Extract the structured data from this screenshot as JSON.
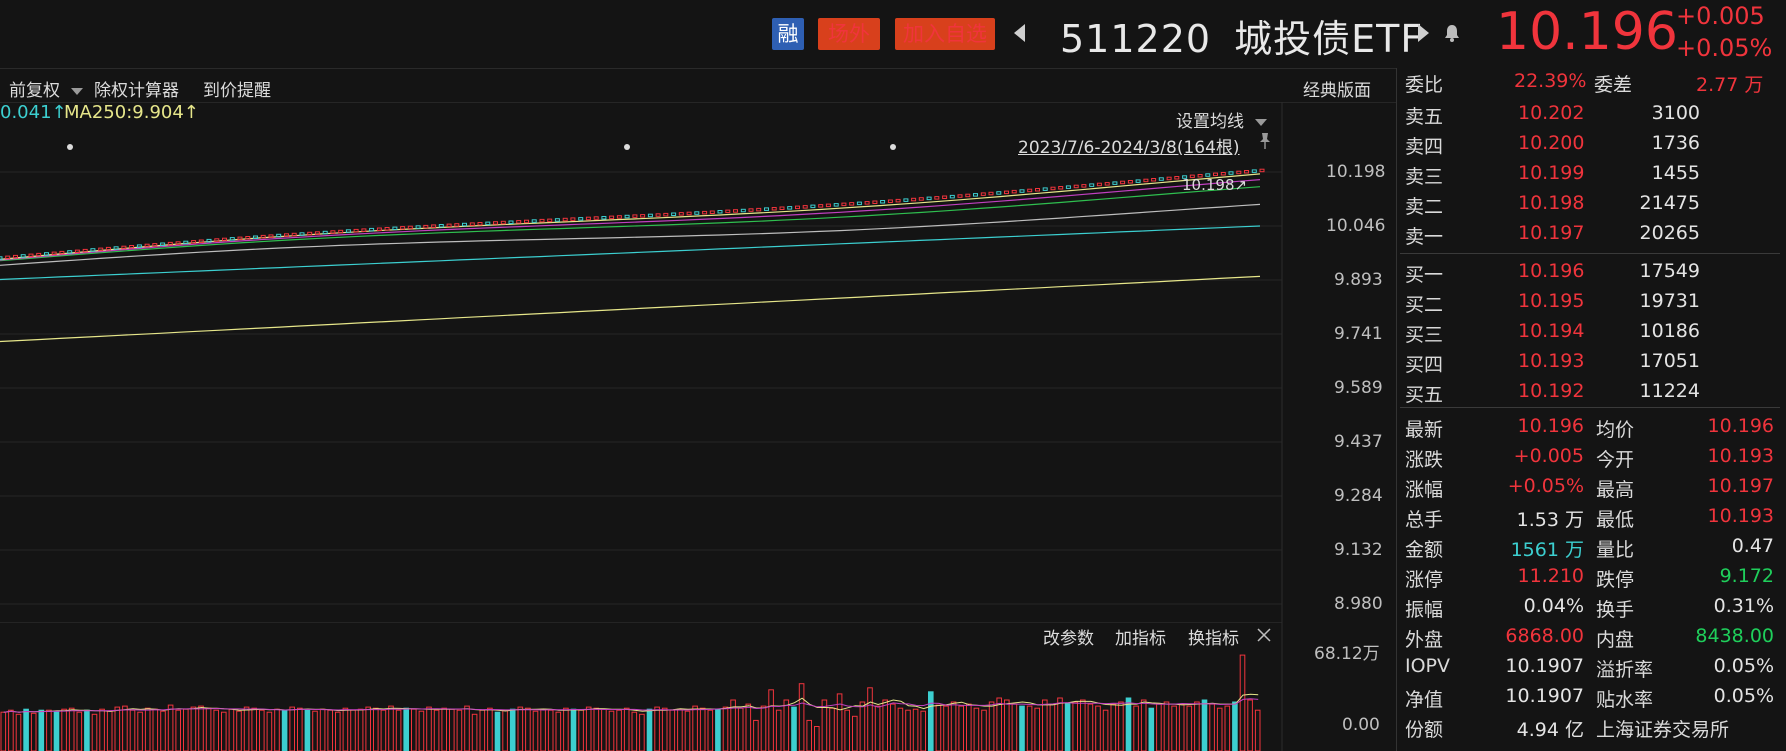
{
  "header": {
    "tag_margin": "融",
    "tag_offsite": "场外",
    "tag_watchlist": "加入自选",
    "code": "511220",
    "name": "城投债ETF",
    "price": "10.196",
    "change": "+0.005",
    "change_pct": "+0.05%"
  },
  "toolbar": {
    "adjust": "前复权",
    "calculator": "除权计算器",
    "alert": "到价提醒",
    "classic": "经典版面",
    "ma_left": "0.041↑",
    "ma250": "MA250:9.904↑",
    "set_ma": "设置均线",
    "range": "2023/7/6-2024/3/8(164根)",
    "last_label": "10.198↗"
  },
  "yaxis": [
    "10.198",
    "10.046",
    "9.893",
    "9.741",
    "9.589",
    "9.437",
    "9.284",
    "9.132",
    "8.980"
  ],
  "volume": {
    "change_params": "改参数",
    "add_indicator": "加指标",
    "switch_indicator": "换指标",
    "max": "68.12万",
    "min": "0.00",
    "bars": [
      0.38,
      0.4,
      0.36,
      0.41,
      0.37,
      0.4,
      0.4,
      0.39,
      0.41,
      0.42,
      0.38,
      0.4,
      0.36,
      0.41,
      0.39,
      0.43,
      0.44,
      0.4,
      0.38,
      0.42,
      0.41,
      0.39,
      0.45,
      0.4,
      0.41,
      0.43,
      0.44,
      0.42,
      0.4,
      0.38,
      0.41,
      0.39,
      0.43,
      0.42,
      0.4,
      0.38,
      0.41,
      0.4,
      0.43,
      0.42,
      0.4,
      0.39,
      0.41,
      0.4,
      0.38,
      0.42,
      0.4,
      0.41,
      0.43,
      0.42,
      0.4,
      0.44,
      0.4,
      0.42,
      0.41,
      0.39,
      0.43,
      0.4,
      0.42,
      0.41,
      0.4,
      0.44,
      0.36,
      0.4,
      0.42,
      0.38,
      0.4,
      0.41,
      0.43,
      0.42,
      0.39,
      0.41,
      0.4,
      0.38,
      0.42,
      0.41,
      0.4,
      0.43,
      0.42,
      0.41,
      0.39,
      0.4,
      0.42,
      0.38,
      0.36,
      0.41,
      0.43,
      0.42,
      0.4,
      0.41,
      0.39,
      0.44,
      0.42,
      0.4,
      0.41,
      0.43,
      0.5,
      0.42,
      0.46,
      0.3,
      0.44,
      0.6,
      0.4,
      0.5,
      0.43,
      0.66,
      0.3,
      0.24,
      0.5,
      0.42,
      0.56,
      0.4,
      0.34,
      0.48,
      0.62,
      0.44,
      0.5,
      0.46,
      0.42,
      0.4,
      0.41,
      0.39,
      0.58,
      0.45,
      0.44,
      0.48,
      0.44,
      0.46,
      0.42,
      0.4,
      0.48,
      0.52,
      0.5,
      0.46,
      0.44,
      0.44,
      0.42,
      0.5,
      0.46,
      0.52,
      0.47,
      0.48,
      0.5,
      0.46,
      0.44,
      0.4,
      0.46,
      0.48,
      0.52,
      0.44,
      0.5,
      0.42,
      0.46,
      0.48,
      0.44,
      0.46,
      0.44,
      0.48,
      0.5,
      0.46,
      0.42,
      0.44,
      0.48,
      0.94,
      0.5,
      0.4
    ],
    "colors": "rrrcrcrcrrrcrrrrrrrrrrrrrrrrrrrrrrrrrcrrcrrrrrrrrrrrrcrrrrrrrrrrrcrcrrrrrrrcrrrrrrrrrcrrrrrrrrcrrrrrrrrrcrrrrrrrrrrrrrrrrrcrrrrrrrrrrrcrrrrrcrrrrrrrcrrcrrrrrrcrrrcrrrrr"
  },
  "panel": {
    "commission_ratio_label": "委比",
    "commission_ratio": "22.39%",
    "commission_diff_label": "委差",
    "commission_diff": "2.77 万",
    "asks": [
      {
        "label": "卖五",
        "price": "10.202",
        "vol": "3100"
      },
      {
        "label": "卖四",
        "price": "10.200",
        "vol": "1736"
      },
      {
        "label": "卖三",
        "price": "10.199",
        "vol": "1455"
      },
      {
        "label": "卖二",
        "price": "10.198",
        "vol": "21475"
      },
      {
        "label": "卖一",
        "price": "10.197",
        "vol": "20265"
      }
    ],
    "bids": [
      {
        "label": "买一",
        "price": "10.196",
        "vol": "17549"
      },
      {
        "label": "买二",
        "price": "10.195",
        "vol": "19731"
      },
      {
        "label": "买三",
        "price": "10.194",
        "vol": "10186"
      },
      {
        "label": "买四",
        "price": "10.193",
        "vol": "17051"
      },
      {
        "label": "买五",
        "price": "10.192",
        "vol": "11224"
      }
    ],
    "stats": [
      {
        "l1": "最新",
        "v1": "10.196",
        "c1": "red",
        "l2": "均价",
        "v2": "10.196",
        "c2": "red"
      },
      {
        "l1": "涨跌",
        "v1": "+0.005",
        "c1": "red",
        "l2": "今开",
        "v2": "10.193",
        "c2": "red"
      },
      {
        "l1": "涨幅",
        "v1": "+0.05%",
        "c1": "red",
        "l2": "最高",
        "v2": "10.197",
        "c2": "red"
      },
      {
        "l1": "总手",
        "v1": "1.53 万",
        "c1": "white",
        "l2": "最低",
        "v2": "10.193",
        "c2": "red"
      },
      {
        "l1": "金额",
        "v1": "1561 万",
        "c1": "cyan",
        "l2": "量比",
        "v2": "0.47",
        "c2": "white"
      },
      {
        "l1": "涨停",
        "v1": "11.210",
        "c1": "red",
        "l2": "跌停",
        "v2": "9.172",
        "c2": "green"
      },
      {
        "l1": "振幅",
        "v1": "0.04%",
        "c1": "white",
        "l2": "换手",
        "v2": "0.31%",
        "c2": "white"
      },
      {
        "l1": "外盘",
        "v1": "6868.00",
        "c1": "red",
        "l2": "内盘",
        "v2": "8438.00",
        "c2": "green"
      },
      {
        "l1": "IOPV",
        "v1": "10.1907",
        "c1": "white",
        "l2": "溢折率",
        "v2": "0.05%",
        "c2": "white"
      },
      {
        "l1": "净值",
        "v1": "10.1907",
        "c1": "white",
        "l2": "贴水率",
        "v2": "0.05%",
        "c2": "white"
      },
      {
        "l1": "份额",
        "v1": "4.94 亿",
        "c1": "white",
        "l2": "上海证券交易所",
        "v2": "",
        "c2": "white"
      }
    ]
  },
  "colors": {
    "up": "#f0343c",
    "down": "#3ccfd0",
    "ma250": "#e6e68a",
    "accent_blue": "#2e5fb3",
    "accent_red": "#d8401c"
  }
}
